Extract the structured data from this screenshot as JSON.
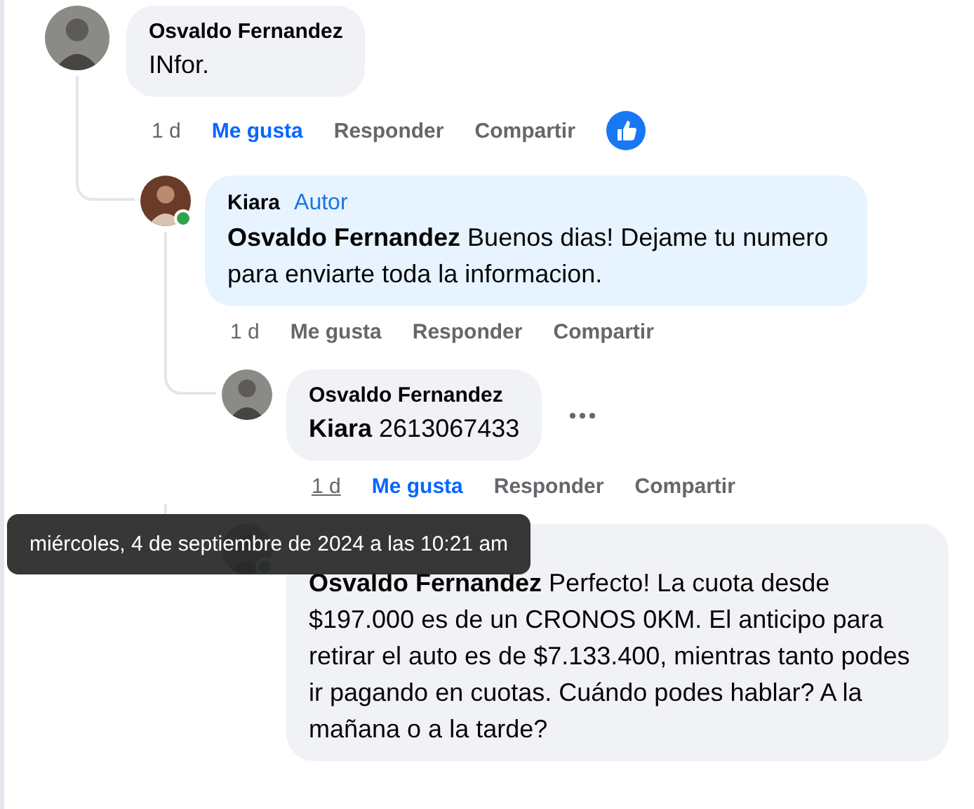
{
  "comments": [
    {
      "author": "Osvaldo Fernandez",
      "text": "INfor.",
      "time": "1 d",
      "time_underlined": false,
      "like": "Me gusta",
      "liked": true,
      "reply": "Responder",
      "share": "Compartir",
      "has_reaction": true,
      "children": [
        {
          "author": "Kiara",
          "author_badge": "Autor",
          "text": "**Osvaldo Fernandez** Buenos dias! Dejame tu numero para enviarte toda la informacion.",
          "is_author": true,
          "time": "1 d",
          "time_underlined": false,
          "like": "Me gusta",
          "liked": false,
          "reply": "Responder",
          "share": "Compartir",
          "online": true,
          "children": [
            {
              "author": "Osvaldo Fernandez",
              "text": "**Kiara** 2613067433",
              "is_author": false,
              "time": "1 d",
              "time_underlined": true,
              "like": "Me gusta",
              "liked": true,
              "reply": "Responder",
              "share": "Compartir",
              "show_menu": true
            },
            {
              "text": "**Osvaldo Fernandez** Perfecto! La cuota desde $197.000 es de un CRONOS 0KM. El anticipo para retirar el auto es de $7.133.400, mientras tanto podes ir pagando en cuotas. Cuándo podes hablar? A la mañana o a la tarde?",
              "is_author": false,
              "online": true
            }
          ]
        }
      ]
    }
  ],
  "tooltip": "miércoles, 4 de septiembre de 2024 a las 10:21 am"
}
